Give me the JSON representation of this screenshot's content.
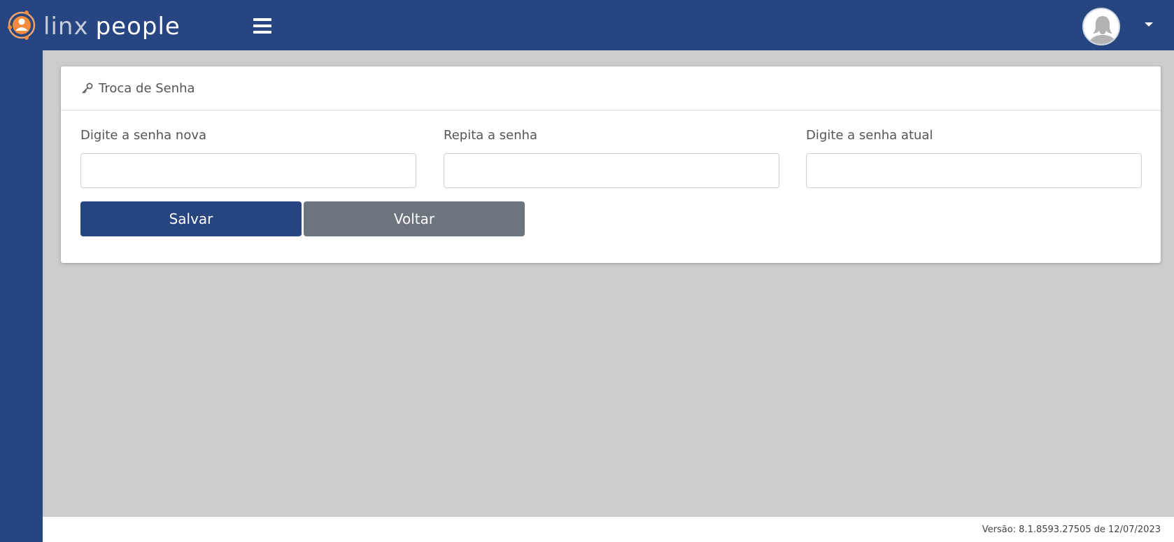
{
  "app": {
    "brand_light": "linx",
    "brand_bold": "people",
    "accent_color": "#264581"
  },
  "header": {
    "menu_icon": "hamburger-icon",
    "user_icon": "user-avatar-icon",
    "dropdown_icon": "caret-down-icon"
  },
  "card": {
    "icon": "key-icon",
    "title": "Troca de Senha",
    "fields": [
      {
        "label": "Digite a senha nova",
        "value": "",
        "placeholder": ""
      },
      {
        "label": "Repita a senha",
        "value": "",
        "placeholder": ""
      },
      {
        "label": "Digite a senha atual",
        "value": "",
        "placeholder": ""
      }
    ],
    "save_label": "Salvar",
    "back_label": "Voltar"
  },
  "footer": {
    "version": "Versão: 8.1.8593.27505 de 12/07/2023"
  }
}
